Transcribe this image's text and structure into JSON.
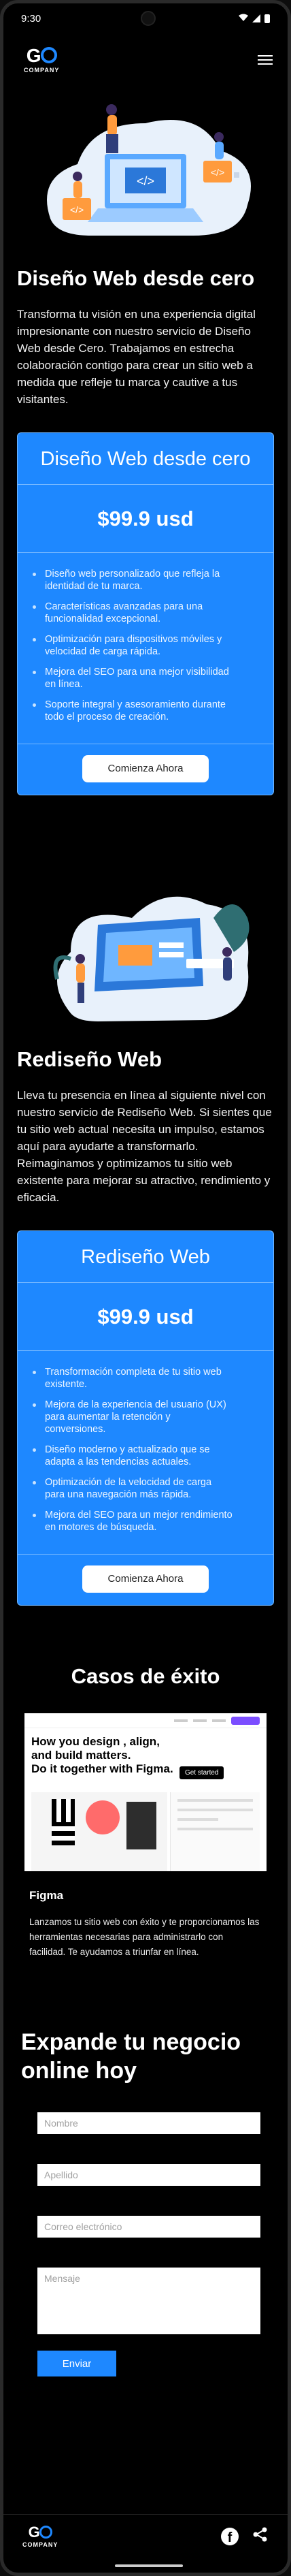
{
  "status": {
    "time": "9:30"
  },
  "brand": {
    "mark": "G",
    "name": "COMPANY"
  },
  "section1": {
    "title": "Diseño Web desde cero",
    "text": "Transforma tu visión en una experiencia digital impresionante con nuestro servicio de Diseño Web desde Cero. Trabajamos en estrecha colaboración contigo para crear un sitio web a medida que refleje tu marca y cautive a tus visitantes.",
    "card": {
      "title": "Diseño Web desde cero",
      "price": "$99.9 usd",
      "features": [
        "Diseño web personalizado que refleja la identidad de tu marca.",
        "Características avanzadas para una funcionalidad excepcional.",
        "Optimización para dispositivos móviles y velocidad de carga rápida.",
        "Mejora del SEO para una mejor visibilidad en línea.",
        "Soporte integral y asesoramiento durante todo el proceso de creación."
      ],
      "cta": "Comienza Ahora"
    }
  },
  "section2": {
    "title": "Rediseño Web",
    "text": "Lleva tu presencia en línea al siguiente nivel con nuestro servicio de Rediseño Web. Si sientes que tu sitio web actual necesita un impulso, estamos aquí para ayudarte a transformarlo. Reimaginamos y optimizamos tu sitio web existente para mejorar su atractivo, rendimiento y eficacia.",
    "card": {
      "title": "Rediseño Web",
      "price": "$99.9 usd",
      "features": [
        "Transformación completa de tu sitio web existente.",
        "Mejora de la experiencia del usuario (UX) para aumentar la retención y conversiones.",
        "Diseño moderno y actualizado que se adapta a las tendencias actuales.",
        "Optimización de la velocidad de carga para una navegación más rápida.",
        "Mejora del SEO para un mejor rendimiento en motores de búsqueda."
      ],
      "cta": "Comienza Ahora"
    }
  },
  "cases": {
    "title": "Casos de éxito",
    "screenshot": {
      "headline_1": "How you design",
      "headline_2": ", align",
      "headline_3": ",",
      "headline_4": "and build",
      "headline_5": " matters.",
      "headline_6": "Do it together with Figma.",
      "cta": "Get started"
    },
    "item_name": "Figma",
    "item_desc": "Lanzamos tu sitio web con éxito y te proporcionamos las herramientas necesarias para administrarlo con facilidad. Te ayudamos a triunfar en línea."
  },
  "contact": {
    "title": "Expande tu negocio online hoy",
    "name_placeholder": "Nombre",
    "surname_placeholder": "Apellido",
    "email_placeholder": "Correo electrónico",
    "message_placeholder": "Mensaje",
    "submit": "Enviar"
  },
  "footer": {
    "facebook_glyph": "f"
  },
  "colors": {
    "accent": "#1e88ff",
    "background": "#000000"
  }
}
